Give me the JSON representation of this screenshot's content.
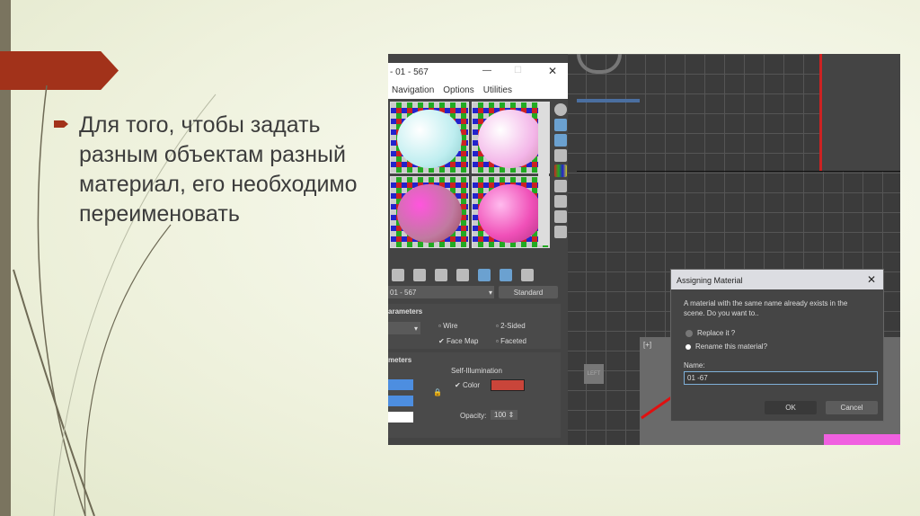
{
  "slide": {
    "bullet_text": "Для того,  чтобы задать разным объектам разный материал, его необходимо переименовать"
  },
  "material_editor": {
    "title": "- 01 - 567",
    "menu": [
      "Navigation",
      "Options",
      "Utilities"
    ],
    "material_name": "01 - 567",
    "material_type": "Standard",
    "shader_section": "arameters",
    "wire": "Wire",
    "two_sided": "2-Sided",
    "face_map": "Face Map",
    "faceted": "Faceted",
    "basic_section": "meters",
    "self_illum_label": "Self-Illumination",
    "color_label": "Color",
    "opacity_label": "Opacity:",
    "opacity_value": "100",
    "self_illum_color": "#c9453a"
  },
  "viewport": {
    "label": "[+]",
    "cube_label": "LEFT"
  },
  "dialog": {
    "title": "Assigning Material",
    "message": "A  material with the same name already exists in the scene. Do you want to..",
    "option_replace": "Replace it ?",
    "option_rename": "Rename this material?",
    "name_label": "Name:",
    "name_value": "01 -67",
    "ok": "OK",
    "cancel": "Cancel"
  }
}
